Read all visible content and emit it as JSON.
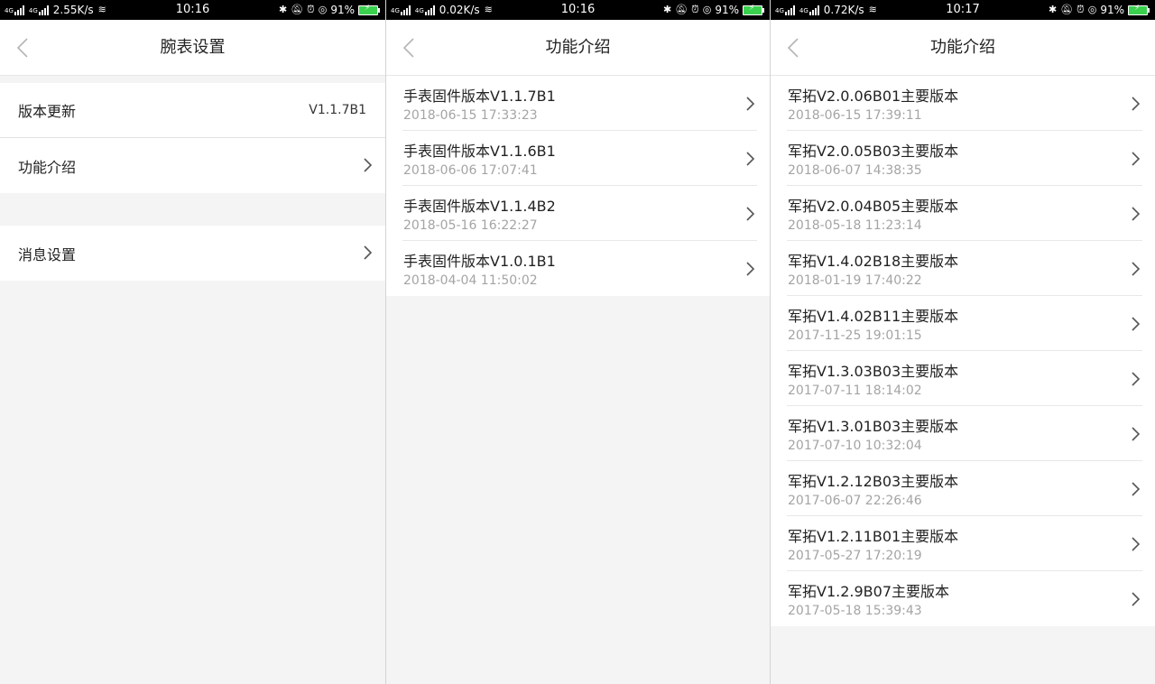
{
  "status_bars": [
    {
      "net_speed": "2.55K/s",
      "time": "10:16",
      "battery": "91%"
    },
    {
      "net_speed": "0.02K/s",
      "time": "10:16",
      "battery": "91%"
    },
    {
      "net_speed": "0.72K/s",
      "time": "10:17",
      "battery": "91%"
    }
  ],
  "status_icons": {
    "network_type": "4G",
    "bluetooth_icon": "bluetooth-icon",
    "mute_icon": "mute-icon",
    "alarm_icon": "alarm-icon",
    "location_icon": "location-icon",
    "battery_icon": "battery-charging-icon",
    "battery_color": "#3ad14e"
  },
  "screen1": {
    "title": "腕表设置",
    "items": [
      {
        "label": "版本更新",
        "value": "V1.1.7B1"
      },
      {
        "label": "功能介绍"
      },
      {
        "label": "消息设置"
      }
    ]
  },
  "screen2": {
    "title": "功能介绍",
    "versions": [
      {
        "name": "手表固件版本V1.1.7B1",
        "date": "2018-06-15 17:33:23"
      },
      {
        "name": "手表固件版本V1.1.6B1",
        "date": "2018-06-06 17:07:41"
      },
      {
        "name": "手表固件版本V1.1.4B2",
        "date": "2018-05-16 16:22:27"
      },
      {
        "name": "手表固件版本V1.0.1B1",
        "date": "2018-04-04 11:50:02"
      }
    ]
  },
  "screen3": {
    "title": "功能介绍",
    "versions": [
      {
        "name": "军拓V2.0.06B01主要版本",
        "date": "2018-06-15 17:39:11"
      },
      {
        "name": "军拓V2.0.05B03主要版本",
        "date": "2018-06-07 14:38:35"
      },
      {
        "name": "军拓V2.0.04B05主要版本",
        "date": "2018-05-18 11:23:14"
      },
      {
        "name": "军拓V1.4.02B18主要版本",
        "date": "2018-01-19 17:40:22"
      },
      {
        "name": "军拓V1.4.02B11主要版本",
        "date": "2017-11-25 19:01:15"
      },
      {
        "name": "军拓V1.3.03B03主要版本",
        "date": "2017-07-11 18:14:02"
      },
      {
        "name": "军拓V1.3.01B03主要版本",
        "date": "2017-07-10 10:32:04"
      },
      {
        "name": "军拓V1.2.12B03主要版本",
        "date": "2017-06-07 22:26:46"
      },
      {
        "name": "军拓V1.2.11B01主要版本",
        "date": "2017-05-27 17:20:19"
      },
      {
        "name": "军拓V1.2.9B07主要版本",
        "date": "2017-05-18 15:39:43"
      }
    ]
  }
}
